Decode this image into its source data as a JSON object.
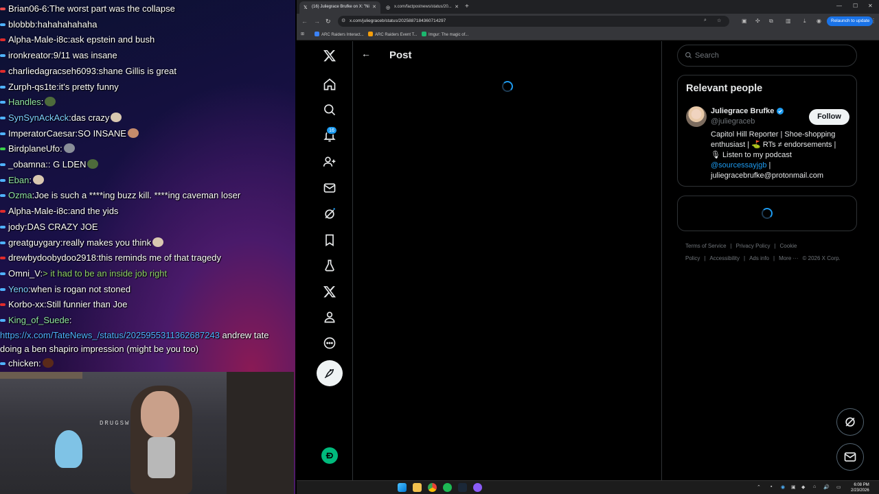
{
  "chat": [
    {
      "user": "Brian06-6",
      "text": "The worst part was the collapse",
      "color": "#ffffff",
      "dot": "#e84b4b"
    },
    {
      "user": "blobbb",
      "text": "hahahahahaha",
      "color": "#ffffff",
      "dot": "#4fb3ff"
    },
    {
      "user": "Alpha-Male-i8c",
      "text": "ask epstein and bush",
      "color": "#ffffff",
      "dot": "#e02b2b"
    },
    {
      "user": "ironkreator",
      "text": "9/11 was insane",
      "color": "#ffffff",
      "dot": "#4fb3ff"
    },
    {
      "user": "charliedagracseh6093",
      "text": "shane Gillis is great",
      "color": "#ffffff",
      "dot": "#e02b2b"
    },
    {
      "user": "Zurph-qs1te",
      "text": "it's pretty funny",
      "color": "#ffffff",
      "dot": "#4fb3ff"
    },
    {
      "user": "Handles",
      "text": "",
      "color": "#8fe3a0",
      "dot": "#4fb3ff"
    },
    {
      "user": "SynSynAckAck",
      "text": "das crazy",
      "color": "#7fd0ff",
      "dot": "#4fb3ff"
    },
    {
      "user": "ImperatorCaesar",
      "text": "SO INSANE",
      "color": "#ffffff",
      "dot": "#4fb3ff"
    },
    {
      "user": "BirdplaneUfo",
      "text": "",
      "color": "#ffffff",
      "dot": "#3ad04a"
    },
    {
      "user": "_obamna",
      "text": ": G LDEN",
      "color": "#ffffff",
      "dot": "#4fb3ff"
    },
    {
      "user": "Eban",
      "text": "",
      "color": "#8fe3a0",
      "dot": "#4fb3ff"
    },
    {
      "user": "Ozma",
      "text": "Joe is such a ****ing buzz kill. ****ing caveman loser",
      "color": "#8fe3a0",
      "dot": "#4fb3ff"
    },
    {
      "user": "Alpha-Male-i8c",
      "text": "and the yids",
      "color": "#ffffff",
      "dot": "#e02b2b"
    },
    {
      "user": "jody",
      "text": "DAS CRAZY JOE",
      "color": "#ffffff",
      "dot": "#4fb3ff"
    },
    {
      "user": "greatguygary",
      "text": "really makes you think",
      "color": "#ffffff",
      "dot": "#4fb3ff"
    },
    {
      "user": "drewbydoobydoo2918",
      "text": "this reminds me of that tragedy",
      "color": "#ffffff",
      "dot": "#e02b2b"
    },
    {
      "user": "Omni_V",
      "text": "> it had to be an inside job right",
      "color": "#ffffff",
      "dot": "#4fb3ff"
    },
    {
      "user": "Yeno",
      "text": "when is rogan not stoned",
      "color": "#7fd0ff",
      "dot": "#4fb3ff"
    },
    {
      "user": "Korbo-xx",
      "text": "Still funnier than Joe",
      "color": "#ffffff",
      "dot": "#e02b2b"
    }
  ],
  "chat_last": {
    "user": "King_of_Suede",
    "link": "https://x.com/TateNews_/status/2025955311362687243",
    "text": "andrew tate doing a ben shapiro impression (might be you too)"
  },
  "chat_tail": {
    "user": "chicken",
    "text": ""
  },
  "cam": {
    "label": "DRUGSWEERS"
  },
  "browser": {
    "tabs": [
      {
        "title": "(16) Juliegrace Brufke on X: \"Ni",
        "active": true
      },
      {
        "title": "x.com/factpostnews/status/20...",
        "active": false
      }
    ],
    "url": "x.com/juliegraceb/status/2025887184360714297",
    "relaunch": "Relaunch to update",
    "bookmarks": [
      "ARC Raiders Interact...",
      "ARC Raiders Event T...",
      "Imgur: The magic of..."
    ]
  },
  "x": {
    "notif_count": "16",
    "page_title": "Post",
    "search_placeholder": "Search",
    "relevant_people_title": "Relevant people",
    "person": {
      "name": "Juliegrace Brufke",
      "handle": "@juliegraceb",
      "follow": "Follow",
      "bio_1": "Capitol Hill Reporter | Shoe-shopping enthusiast | ",
      "bio_1b": " RTs ≠ endorsements | ",
      "bio_2": " Listen to my podcast",
      "bio_link": "@sourcessayjgb",
      "bio_sep": " |",
      "bio_email": "juliegracebrufke@protonmail.com"
    },
    "footer": [
      "Terms of Service",
      "|",
      "Privacy Policy",
      "|",
      "Cookie Policy",
      "|",
      "Accessibility",
      "|",
      "Ads info",
      "|",
      "More ···",
      "© 2026 X Corp."
    ]
  },
  "taskbar": {
    "time": "6:08 PM",
    "date": "2/23/2026"
  },
  "colors": {
    "x_blue": "#1d9bf0",
    "border": "#2f3336",
    "muted": "#71767b"
  }
}
